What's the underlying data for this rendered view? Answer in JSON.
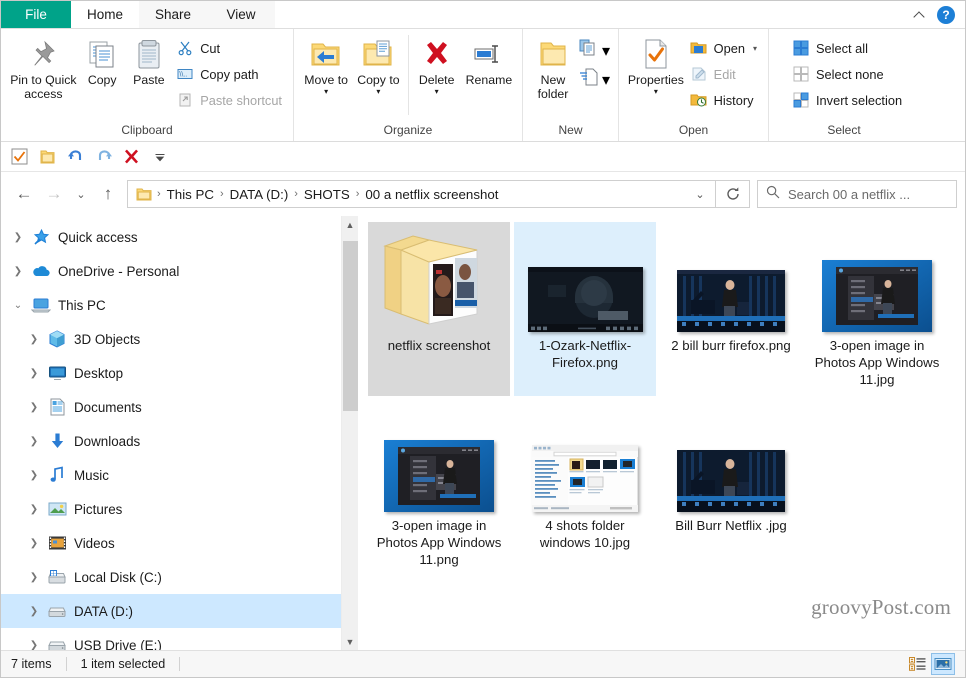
{
  "window": {
    "tabs": [
      {
        "id": "file",
        "label": "File",
        "state": "file"
      },
      {
        "id": "home",
        "label": "Home",
        "state": "active"
      },
      {
        "id": "share",
        "label": "Share",
        "state": "normal"
      },
      {
        "id": "view",
        "label": "View",
        "state": "normal"
      }
    ],
    "collapse_icon": "chevron-up-icon",
    "help_icon": "help-icon",
    "help_label": "?"
  },
  "ribbon": {
    "groups": [
      {
        "id": "clipboard",
        "label": "Clipboard"
      },
      {
        "id": "organize",
        "label": "Organize"
      },
      {
        "id": "new",
        "label": "New"
      },
      {
        "id": "open",
        "label": "Open"
      },
      {
        "id": "select",
        "label": "Select"
      }
    ],
    "clipboard": {
      "pin_label": "Pin to Quick access",
      "copy_label": "Copy",
      "paste_label": "Paste",
      "cut_label": "Cut",
      "copy_path_label": "Copy path",
      "paste_shortcut_label": "Paste shortcut"
    },
    "organize": {
      "move_to_label": "Move to",
      "copy_to_label": "Copy to",
      "delete_label": "Delete",
      "rename_label": "Rename"
    },
    "new": {
      "new_folder_label": "New folder",
      "new_item_label": "",
      "easy_access_label": ""
    },
    "open": {
      "properties_label": "Properties",
      "open_label": "Open",
      "edit_label": "Edit",
      "history_label": "History"
    },
    "select": {
      "select_all_label": "Select all",
      "select_none_label": "Select none",
      "invert_selection_label": "Invert selection"
    }
  },
  "quick_access_toolbar": {
    "items": [
      {
        "id": "properties",
        "icon": "properties-checkbox-icon"
      },
      {
        "id": "new-folder",
        "icon": "new-folder-icon"
      },
      {
        "id": "undo",
        "icon": "undo-icon"
      },
      {
        "id": "redo",
        "icon": "redo-icon"
      },
      {
        "id": "delete",
        "icon": "delete-x-icon"
      },
      {
        "id": "customize",
        "icon": "chevron-down-icon"
      }
    ]
  },
  "address_bar": {
    "back_icon": "back-arrow-icon",
    "forward_icon": "forward-arrow-icon",
    "recent_icon": "chevron-down-icon",
    "up_icon": "up-arrow-icon",
    "folder_icon": "folder-icon",
    "breadcrumbs": [
      "This PC",
      "DATA (D:)",
      "SHOTS",
      "00 a netflix screenshot"
    ],
    "separator": "›",
    "dropdown_icon": "chevron-down-icon",
    "refresh_icon": "refresh-icon"
  },
  "search": {
    "icon": "search-icon",
    "placeholder": "Search 00 a netflix ..."
  },
  "nav_pane": {
    "items": [
      {
        "label": "Quick access",
        "icon": "star-pin-icon",
        "level": 1,
        "expanded": false,
        "selected": false
      },
      {
        "label": "OneDrive - Personal",
        "icon": "onedrive-cloud-icon",
        "level": 1,
        "expanded": false,
        "selected": false
      },
      {
        "label": "This PC",
        "icon": "this-pc-icon",
        "level": 1,
        "expanded": true,
        "selected": false
      },
      {
        "label": "3D Objects",
        "icon": "3d-objects-icon",
        "level": 2,
        "expanded": false,
        "selected": false
      },
      {
        "label": "Desktop",
        "icon": "desktop-icon",
        "level": 2,
        "expanded": false,
        "selected": false
      },
      {
        "label": "Documents",
        "icon": "documents-icon",
        "level": 2,
        "expanded": false,
        "selected": false
      },
      {
        "label": "Downloads",
        "icon": "downloads-icon",
        "level": 2,
        "expanded": false,
        "selected": false
      },
      {
        "label": "Music",
        "icon": "music-icon",
        "level": 2,
        "expanded": false,
        "selected": false
      },
      {
        "label": "Pictures",
        "icon": "pictures-icon",
        "level": 2,
        "expanded": false,
        "selected": false
      },
      {
        "label": "Videos",
        "icon": "videos-icon",
        "level": 2,
        "expanded": false,
        "selected": false
      },
      {
        "label": "Local Disk (C:)",
        "icon": "local-disk-icon",
        "level": 2,
        "expanded": false,
        "selected": false
      },
      {
        "label": "DATA (D:)",
        "icon": "drive-icon",
        "level": 2,
        "expanded": false,
        "selected": true
      },
      {
        "label": "USB Drive (E:)",
        "icon": "usb-drive-icon",
        "level": 2,
        "expanded": false,
        "selected": false
      }
    ]
  },
  "files": [
    {
      "name": "netflix screenshot",
      "kind": "folder",
      "state": "hover",
      "thumb": "folder-with-pictures"
    },
    {
      "name": "1-Ozark-Netflix-Firefox.png",
      "kind": "image",
      "state": "selected",
      "thumb": "ozark-dark-video"
    },
    {
      "name": "2 bill burr firefox.png",
      "kind": "image",
      "state": "normal",
      "thumb": "bill-burr-stage"
    },
    {
      "name": "3-open image in Photos App Windows 11.jpg",
      "kind": "image",
      "state": "normal",
      "thumb": "photos-app-blue"
    },
    {
      "name": "3-open image in Photos App Windows 11.png",
      "kind": "image",
      "state": "normal",
      "thumb": "photos-app-blue"
    },
    {
      "name": "4 shots folder windows 10.jpg",
      "kind": "image",
      "state": "normal",
      "thumb": "explorer-window-light"
    },
    {
      "name": "Bill Burr Netflix .jpg",
      "kind": "image",
      "state": "normal",
      "thumb": "bill-burr-stage"
    }
  ],
  "status_bar": {
    "item_count": "7 items",
    "selection_count": "1 item selected",
    "details_view_icon": "details-view-icon",
    "large_icons_view_icon": "large-icons-view-icon",
    "active_view": "large-icons-view"
  },
  "watermark": "groovyPost.com",
  "colors": {
    "file_tab": "#00a389",
    "selection_blue": "#cde8ff",
    "cell_selected": "#ddeffc",
    "accent_blue": "#1d7fd6",
    "folder_yellow": "#fbd66a"
  }
}
